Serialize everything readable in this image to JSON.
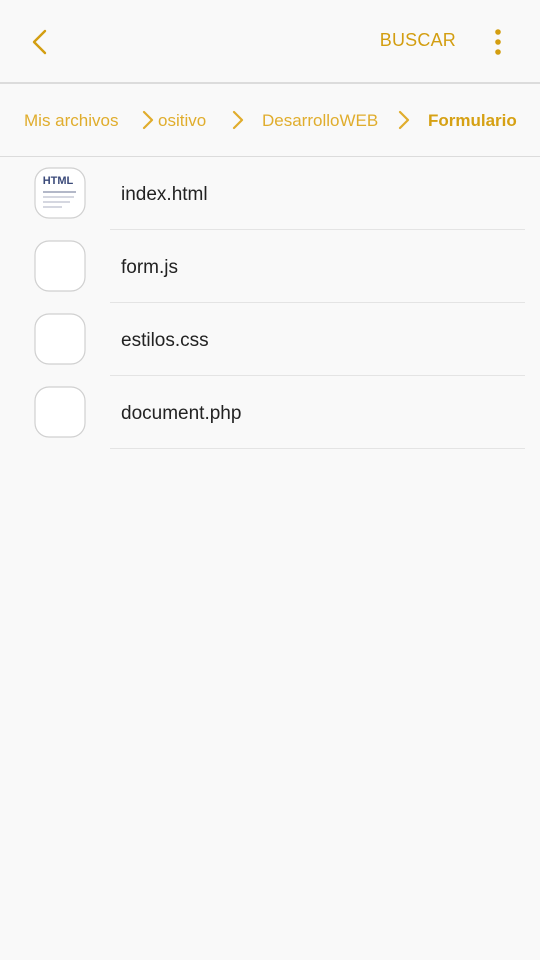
{
  "appbar": {
    "back_icon": "chevron-left-icon",
    "search_label": "BUSCAR",
    "more_icon": "more-vertical-icon",
    "accent_color": "#d39e11"
  },
  "breadcrumb": {
    "items": [
      {
        "label": "Mis archivos"
      },
      {
        "label": "ositivo"
      },
      {
        "label": "DesarrolloWEB"
      },
      {
        "label": "Formulario"
      }
    ],
    "separator_icon": "chevron-right-icon"
  },
  "files": [
    {
      "name": "index.html",
      "icon": "html-file-icon",
      "icon_text": "HTML"
    },
    {
      "name": "form.js",
      "icon": "blank-file-icon"
    },
    {
      "name": "estilos.css",
      "icon": "blank-file-icon"
    },
    {
      "name": "document.php",
      "icon": "blank-file-icon"
    }
  ]
}
